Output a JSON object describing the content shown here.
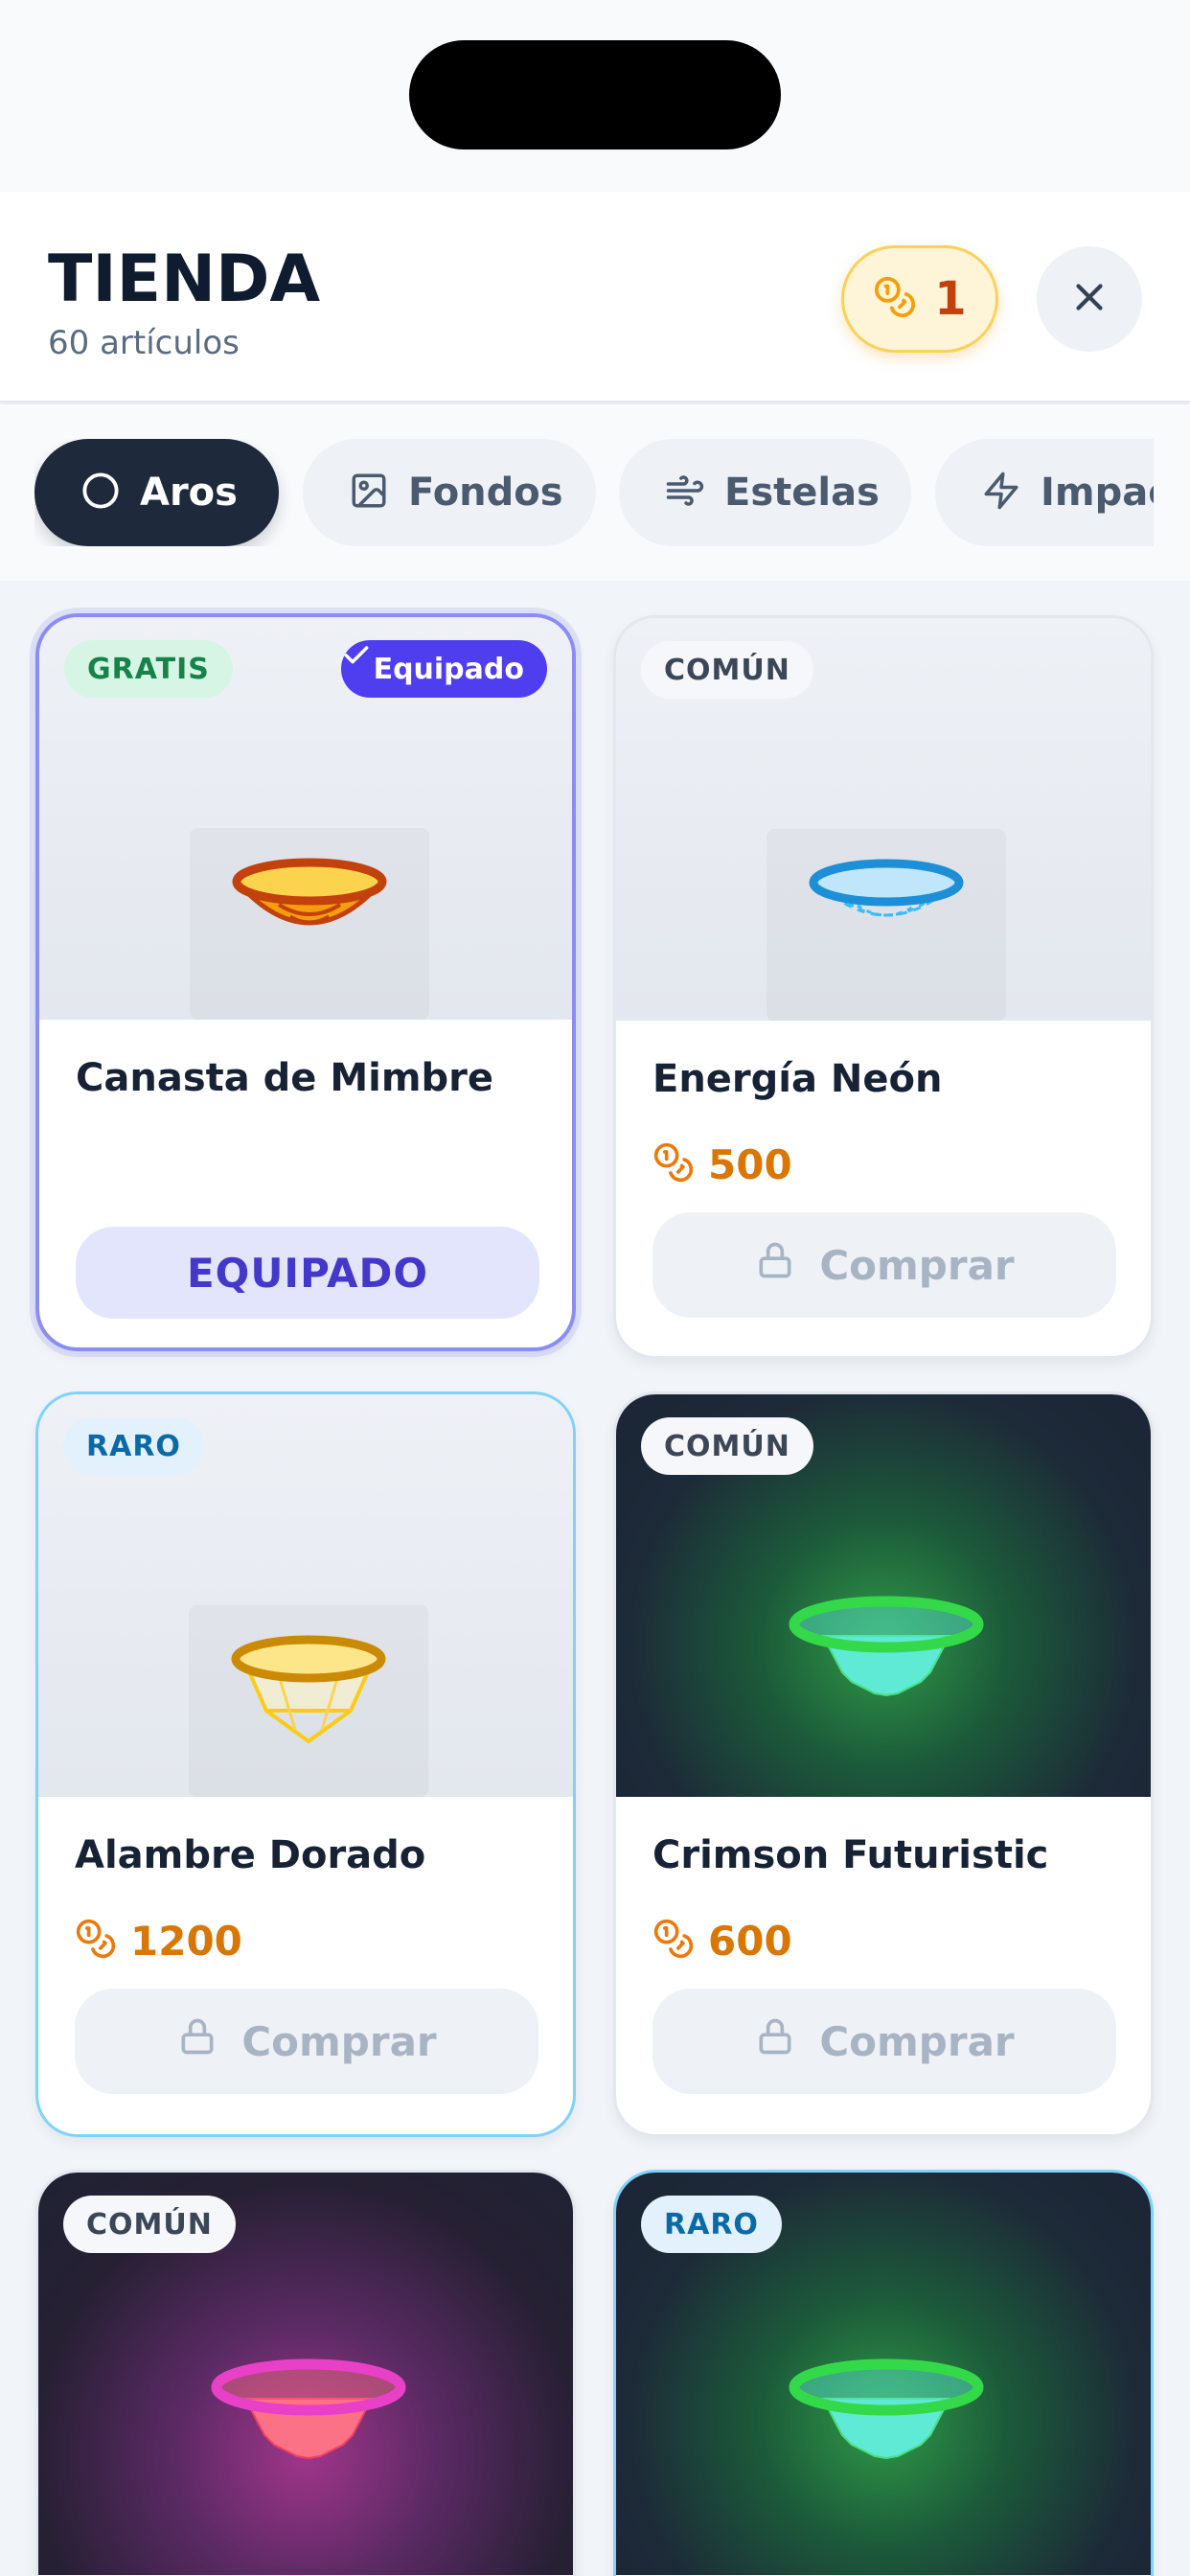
{
  "header": {
    "title": "TIENDA",
    "subtitle": "60 artículos",
    "coins": "1"
  },
  "tabs": [
    {
      "label": "Aros",
      "icon": "circle-icon",
      "active": true
    },
    {
      "label": "Fondos",
      "icon": "image-icon",
      "active": false
    },
    {
      "label": "Estelas",
      "icon": "wind-icon",
      "active": false
    },
    {
      "label": "Impac",
      "icon": "bolt-icon",
      "active": false
    }
  ],
  "items": [
    {
      "name": "Canasta de Mimbre",
      "badge": "GRATIS",
      "equipped_badge": "Equipado",
      "action": "EQUIPADO",
      "price": null,
      "preview": "light"
    },
    {
      "name": "Energía Neón",
      "badge": "COMÚN",
      "price": "500",
      "action": "Comprar",
      "preview": "light"
    },
    {
      "name": "Alambre Dorado",
      "badge": "RARO",
      "price": "1200",
      "action": "Comprar",
      "preview": "light"
    },
    {
      "name": "Crimson Futuristic",
      "badge": "COMÚN",
      "price": "600",
      "action": "Comprar",
      "preview": "green"
    },
    {
      "name": "",
      "badge": "COMÚN",
      "preview": "purple"
    },
    {
      "name": "",
      "badge": "RARO",
      "preview": "green"
    }
  ],
  "colors": {
    "accent": "#4f3df0",
    "coin": "#d97706",
    "dark": "#1e293b",
    "free_badge": "#16834b",
    "rare_badge": "#0b6aa5"
  }
}
